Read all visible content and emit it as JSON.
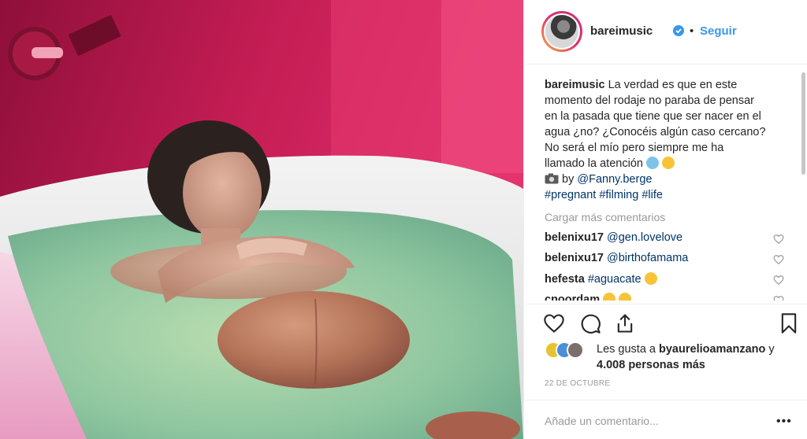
{
  "post": {
    "username": "bareimusic",
    "follow_label": "Seguir",
    "separator": "•",
    "caption_user": "bareimusic",
    "caption_lines": [
      "La verdad es que en este",
      "momento del rodaje no paraba de pensar",
      "en la pasada que tiene que ser nacer en el",
      "agua ¿no? ¿Conocéis algún caso cercano?",
      "No será el mío pero siempre me ha",
      "llamado la atención"
    ],
    "credit_prefix": "by",
    "credit_link": "@Fanny.berge",
    "hashtags": [
      "#pregnant",
      "#filming",
      "#life"
    ],
    "load_more": "Cargar más comentarios",
    "comments": [
      {
        "user": "belenixu17",
        "text": "@gen.lovelove"
      },
      {
        "user": "belenixu17",
        "text": "@birthofamama"
      },
      {
        "user": "hefesta",
        "text": "#aguacate"
      },
      {
        "user": "cnoordam",
        "text": ""
      }
    ],
    "likes_prefix": "Les gusta a",
    "likes_user": "byaurelioamanzano",
    "likes_and": "y",
    "likes_count": "4.008 personas más",
    "date": "22 DE OCTUBRE",
    "add_comment_placeholder": "Añade un comentario...",
    "more_label": "•••"
  },
  "colors": {
    "accent": "#3897f0",
    "link": "#003569",
    "muted": "#999999",
    "text": "#262626"
  },
  "icons": [
    "verified-badge-icon",
    "heart-icon",
    "comment-icon",
    "share-icon",
    "bookmark-icon",
    "camera-icon"
  ]
}
